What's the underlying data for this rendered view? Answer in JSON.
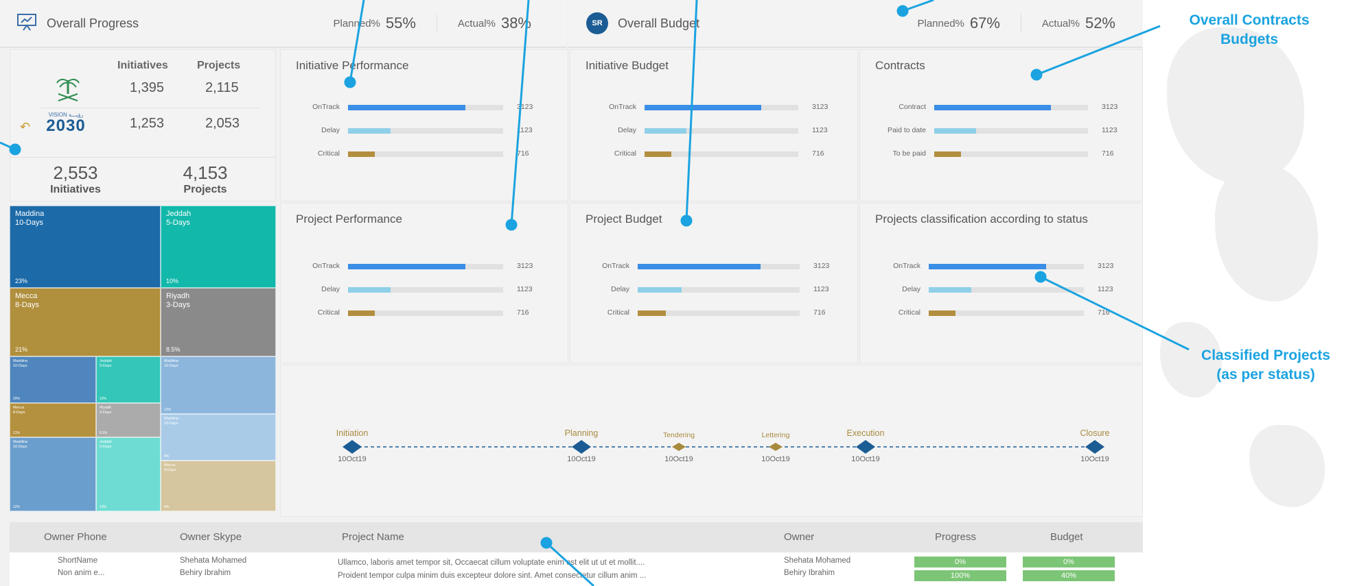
{
  "header": {
    "progress": {
      "title": "Overall Progress",
      "planned_label": "Planned%",
      "planned_value": "55%",
      "actual_label": "Actual%",
      "actual_value": "38%"
    },
    "budget": {
      "title": "Overall Budget",
      "icon_text": "SR",
      "planned_label": "Planned%",
      "planned_value": "67%",
      "actual_label": "Actual%",
      "actual_value": "52%"
    }
  },
  "summary": {
    "col_initiatives": "Initiatives",
    "col_projects": "Projects",
    "rows": [
      {
        "initiatives": "1,395",
        "projects": "2,115"
      },
      {
        "initiatives": "1,253",
        "projects": "2,053"
      }
    ],
    "vision_small": "VISION رؤيـــة",
    "vision_big": "2030",
    "totals": [
      {
        "value": "2,553",
        "label": "Initiatives"
      },
      {
        "value": "4,153",
        "label": "Projects"
      }
    ]
  },
  "treemap": [
    {
      "name": "Maddina",
      "days": "10-Days",
      "pct": "23%",
      "color": "#1c6aa8"
    },
    {
      "name": "Jeddah",
      "days": "5-Days",
      "pct": "10%",
      "color": "#12b8aa"
    },
    {
      "name": "Mecca",
      "days": "8-Days",
      "pct": "21%",
      "color": "#b08f3d"
    },
    {
      "name": "Riyadh",
      "days": "3-Days",
      "pct": "8.5%",
      "color": "#8a8a8a"
    },
    {
      "name": "Maddina",
      "days": "10-Days",
      "pct": "20%",
      "color": "#4f86bd"
    },
    {
      "name": "Jeddah",
      "days": "5-Days",
      "pct": "10%",
      "color": "#34c6b8"
    },
    {
      "name": "Maddina",
      "days": "10-Days",
      "pct": "12%",
      "color": "#8cb6dc"
    },
    {
      "name": "Mecca",
      "days": "8-Days",
      "pct": "21%",
      "color": "#b4913f"
    },
    {
      "name": "Riyadh",
      "days": "3-Days",
      "pct": "8.5%",
      "color": "#ababab"
    },
    {
      "name": "Maddina",
      "days": "10-Days",
      "pct": "8%",
      "color": "#a9cbe8"
    },
    {
      "name": "Maddina",
      "days": "10-Days",
      "pct": "12%",
      "color": "#6a9ecc"
    },
    {
      "name": "Jeddah",
      "days": "5-Days",
      "pct": "10%",
      "color": "#6fdcd3"
    },
    {
      "name": "Mecca",
      "days": "8-Days",
      "pct": "4%",
      "color": "#d6c69f"
    }
  ],
  "bar_panels": [
    {
      "title": "Initiative Performance",
      "rows": [
        {
          "label": "OnTrack",
          "value": 3123,
          "display": "3123"
        },
        {
          "label": "Delay",
          "value": 1123,
          "display": "1123"
        },
        {
          "label": "Critical",
          "value": 716,
          "display": "716"
        }
      ]
    },
    {
      "title": "Initiative Budget",
      "rows": [
        {
          "label": "OnTrack",
          "value": 3123,
          "display": "3123"
        },
        {
          "label": "Delay",
          "value": 1123,
          "display": "1123"
        },
        {
          "label": "Critical",
          "value": 716,
          "display": "716"
        }
      ]
    },
    {
      "title": "Contracts",
      "rows": [
        {
          "label": "Contract",
          "value": 3123,
          "display": "3123"
        },
        {
          "label": "Paid to date",
          "value": 1123,
          "display": "1123"
        },
        {
          "label": "To be paid",
          "value": 716,
          "display": "716"
        }
      ]
    },
    {
      "title": "Project Performance",
      "rows": [
        {
          "label": "OnTrack",
          "value": 3123,
          "display": "3123"
        },
        {
          "label": "Delay",
          "value": 1123,
          "display": "1123"
        },
        {
          "label": "Critical",
          "value": 716,
          "display": "716"
        }
      ]
    },
    {
      "title": "Project Budget",
      "rows": [
        {
          "label": "OnTrack",
          "value": 3123,
          "display": "3123"
        },
        {
          "label": "Delay",
          "value": 1123,
          "display": "1123"
        },
        {
          "label": "Critical",
          "value": 716,
          "display": "716"
        }
      ]
    },
    {
      "title": "Projects classification according to status",
      "rows": [
        {
          "label": "OnTrack",
          "value": 3123,
          "display": "3123"
        },
        {
          "label": "Delay",
          "value": 1123,
          "display": "1123"
        },
        {
          "label": "Critical",
          "value": 716,
          "display": "716"
        }
      ]
    }
  ],
  "bar_colors": [
    "#3a8ee6",
    "#8fd0e8",
    "#b28e3e"
  ],
  "timeline": [
    {
      "label": "Initiation",
      "date": "10Oct19",
      "major": true
    },
    {
      "label": "Planning",
      "date": "10Oct19",
      "major": true
    },
    {
      "label": "Tendering",
      "date": "10Oct19",
      "major": false
    },
    {
      "label": "Lettering",
      "date": "10Oct19",
      "major": false
    },
    {
      "label": "Execution",
      "date": "10Oct19",
      "major": true
    },
    {
      "label": "Closure",
      "date": "10Oct19",
      "major": true
    }
  ],
  "table": {
    "headers": [
      "Owner Phone",
      "Owner Skype",
      "Project Name",
      "Owner",
      "Progress",
      "Budget"
    ],
    "rows": [
      {
        "phone": "ShortName",
        "skype": "Shehata Mohamed",
        "project": "Ullamco, laboris amet tempor sit, Occaecat cillum voluptate enim est elit ut ut et mollit....",
        "owner": "Shehata Mohamed",
        "progress": "0%",
        "budget": "0%"
      },
      {
        "phone": "Non anim e...",
        "skype": "Behiry Ibrahim",
        "project": "Proident tempor culpa minim duis excepteur dolore sint. Amet consectetur cillum anim ...",
        "owner": "Behiry Ibrahim",
        "progress": "100%",
        "budget": "40%"
      }
    ]
  },
  "callouts": {
    "contracts": "Overall Contracts\nBudgets",
    "classified": "Classified Projects\n(as per status)"
  }
}
